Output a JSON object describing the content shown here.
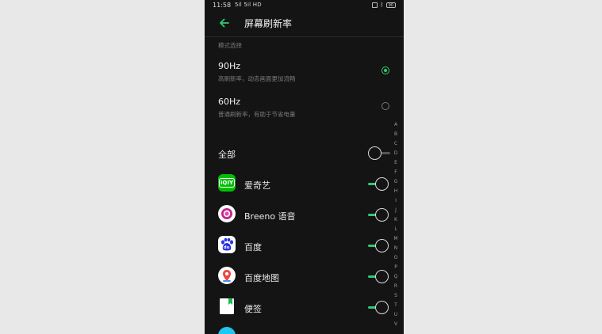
{
  "status_bar": {
    "time": "11:58",
    "network": "5il 5il HD",
    "battery": "90"
  },
  "header": {
    "title": "屏幕刷新率"
  },
  "mode_section": {
    "label": "模式选择",
    "options": [
      {
        "title": "90Hz",
        "subtitle": "高刷新率，动态画面更加流畅",
        "selected": true
      },
      {
        "title": "60Hz",
        "subtitle": "普通刷新率，有助于节省电量",
        "selected": false
      }
    ]
  },
  "all_toggle": {
    "label": "全部",
    "on": false
  },
  "apps": [
    {
      "name": "爱奇艺",
      "icon": "iqiyi-app-icon",
      "icon_text": "iQIY",
      "on": true
    },
    {
      "name": "Breeno 语音",
      "icon": "breeno-app-icon",
      "on": true
    },
    {
      "name": "百度",
      "icon": "baidu-app-icon",
      "icon_text": "du",
      "on": true
    },
    {
      "name": "百度地图",
      "icon": "baidu-map-app-icon",
      "on": true
    },
    {
      "name": "便签",
      "icon": "notes-app-icon",
      "on": true
    }
  ],
  "alphabet_index": [
    "A",
    "B",
    "C",
    "D",
    "E",
    "F",
    "G",
    "H",
    "I",
    "J",
    "K",
    "L",
    "M",
    "N",
    "O",
    "P",
    "Q",
    "R",
    "S",
    "T",
    "U",
    "V"
  ],
  "colors": {
    "accent": "#2ecc71",
    "background": "#141414"
  }
}
